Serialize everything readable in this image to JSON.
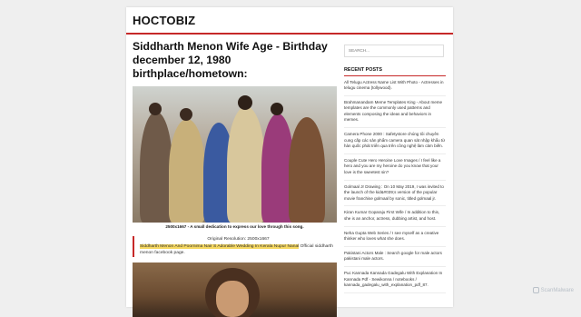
{
  "site": {
    "title": "HOCTOBIZ"
  },
  "post": {
    "title": "Siddharth Menon Wife Age - Birthday december 12, 1980 birthplace/hometown:",
    "image_caption": "2500x1667 - A small dedication to express our love through this song.",
    "original_resolution": "Original Resolution: 2500x1667",
    "highlight_text": "Siddharth Menon And Poornima Nair S Adorable Wedding In Kerala Nupur Nanal",
    "after_highlight": " Official siddharth menon facebook page."
  },
  "sidebar": {
    "search_placeholder": "SEARCH...",
    "recent_posts_title": "RECENT POSTS",
    "recent_posts": [
      "All Telugu Actress Name List With Photo - Actresses in telugu cinema (tollywood).",
      "Brahmanandam Meme Templates King - About meme templates are the commonly used patterns and elements composing the ideas and behaviors in memes.",
      "Camera Phone 2000 : Safetystore chúng tôi chuyên cung cấp các sản phẩm camera quan sát nhập khẩu từ hàn quốc phát triển qua trên công nghệ làm cảm biến.",
      "Couple Cute Hero Heroine Love Images / I feel like a hero and you are my heroine do you know that your love is the sweetest sin?",
      "Golmaal Jr Drawing : On 10 May 2019, I was invited to the launch of the kid&#039;s version of the popular movie franchise golmaal by sonic, titled golmaal jr.",
      "Kiran Kumar Goparaju First Wife / In addition to this, she is an anchor, actress, dubbing artist, and host.",
      "Neha Gupta Web Series / I see myself as a creative thinker who loves what she does.",
      "Pakistani Actors Male : Search google for male actors pakistani male actors.",
      "Puc Kannada Kannada Gadegalu With Explanation In Kannada Pdf - Sewikonna / notebooks / kannada_gadegalu_with_explanation_pdf_87."
    ]
  },
  "watermark": {
    "text": "ScanMalware"
  },
  "colors": {
    "accent": "#c62828",
    "highlight": "#f6d860"
  }
}
